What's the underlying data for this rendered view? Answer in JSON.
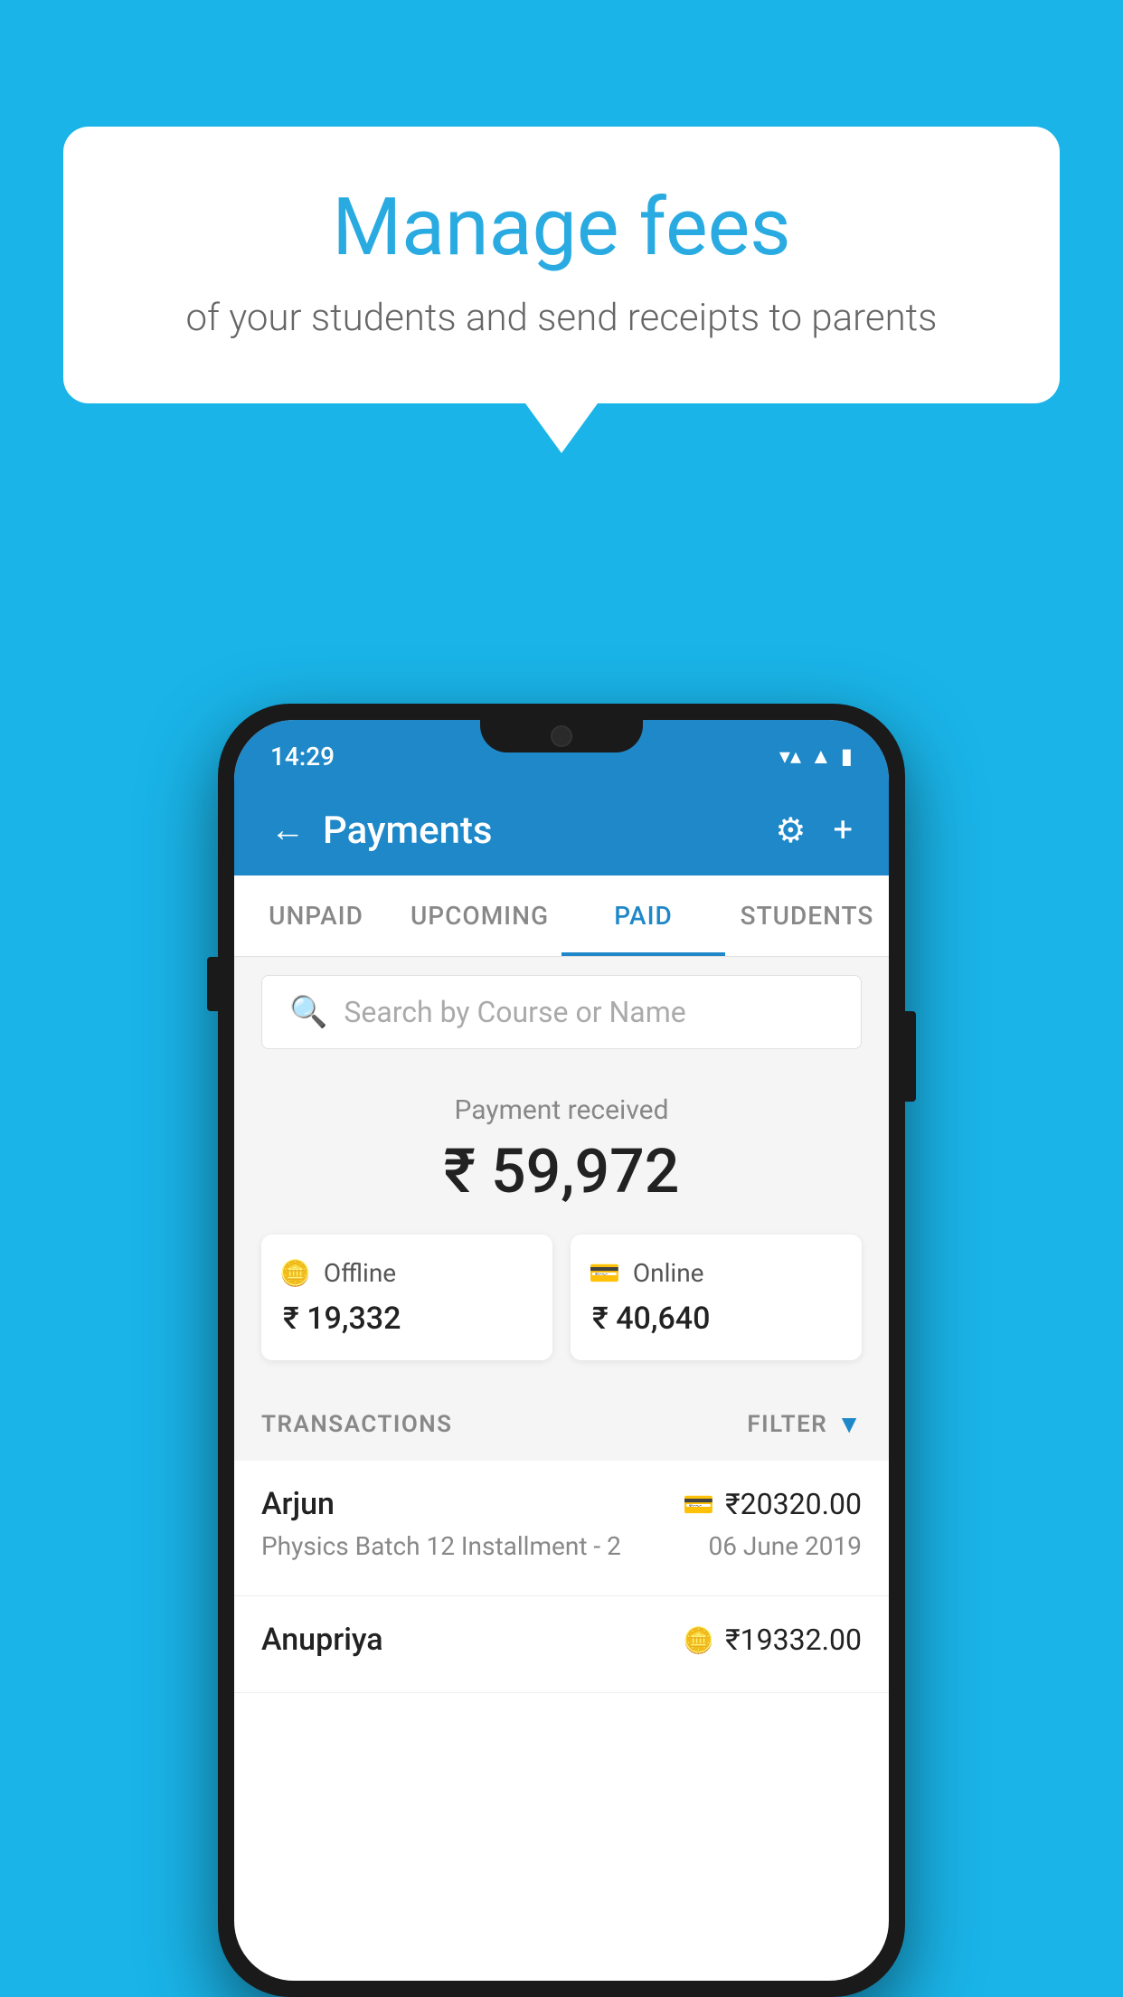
{
  "background_color": "#1ab4e8",
  "bubble": {
    "title": "Manage fees",
    "subtitle": "of your students and send receipts to parents"
  },
  "status_bar": {
    "time": "14:29",
    "wifi": "▾",
    "signal": "▲",
    "battery": "▮"
  },
  "header": {
    "title": "Payments",
    "back_label": "←",
    "gear_label": "⚙",
    "plus_label": "+"
  },
  "tabs": [
    {
      "label": "UNPAID",
      "active": false
    },
    {
      "label": "UPCOMING",
      "active": false
    },
    {
      "label": "PAID",
      "active": true
    },
    {
      "label": "STUDENTS",
      "active": false
    }
  ],
  "search": {
    "placeholder": "Search by Course or Name"
  },
  "payment": {
    "received_label": "Payment received",
    "total_amount": "₹ 59,972",
    "offline_label": "Offline",
    "offline_amount": "₹ 19,332",
    "online_label": "Online",
    "online_amount": "₹ 40,640"
  },
  "transactions": {
    "header_label": "TRANSACTIONS",
    "filter_label": "FILTER"
  },
  "transaction_items": [
    {
      "name": "Arjun",
      "course": "Physics Batch 12 Installment - 2",
      "amount": "₹20320.00",
      "date": "06 June 2019",
      "mode": "card"
    },
    {
      "name": "Anupriya",
      "course": "",
      "amount": "₹19332.00",
      "date": "",
      "mode": "cash"
    }
  ]
}
